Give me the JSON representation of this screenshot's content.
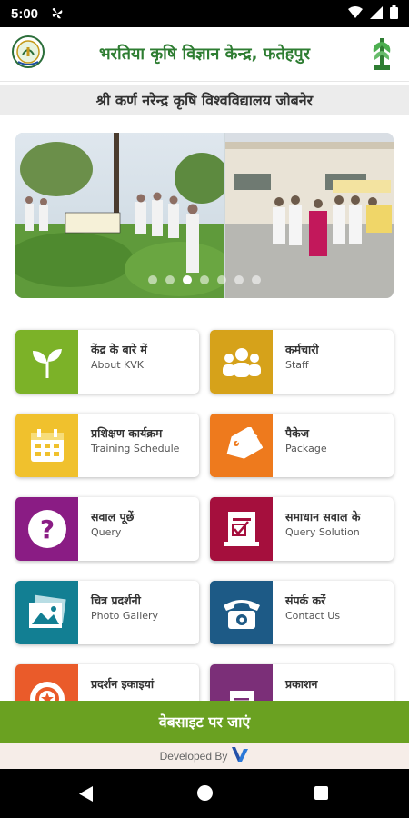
{
  "status_bar": {
    "time": "5:00",
    "left_icon": "fan-icon",
    "right_icons": [
      "wifi-icon",
      "signal-icon",
      "battery-icon"
    ]
  },
  "header": {
    "title": "भरतिया कृषि विज्ञान केन्द्र, फतेहपुर",
    "left_logo": "university-emblem-logo",
    "right_logo": "icar-logo"
  },
  "university": {
    "name": "श्री कर्ण नरेन्द्र कृषि विश्वविद्यालय जोबनेर"
  },
  "carousel": {
    "slide_count": 7,
    "active_index": 2
  },
  "menu": [
    {
      "hi": "केंद्र के बारे में",
      "en": "About KVK",
      "color": "#7cb228",
      "icon": "plant-sprout-icon"
    },
    {
      "hi": "कर्मचारी",
      "en": "Staff",
      "color": "#d6a21a",
      "icon": "people-group-icon"
    },
    {
      "hi": "प्रशिक्षण कार्यक्रम",
      "en": "Training Schedule",
      "color": "#f0c12d",
      "icon": "calendar-icon"
    },
    {
      "hi": "पैकेज",
      "en": "Package",
      "color": "#ee7a1d",
      "icon": "tag-icon"
    },
    {
      "hi": "सवाल पूछें",
      "en": "Query",
      "color": "#8a1c84",
      "icon": "question-icon"
    },
    {
      "hi": "समाधान सवाल के",
      "en": "Query Solution",
      "color": "#a50f3d",
      "icon": "document-check-icon"
    },
    {
      "hi": "चित्र प्रदर्शनी",
      "en": "Photo Gallery",
      "color": "#127f93",
      "icon": "photo-gallery-icon"
    },
    {
      "hi": "संपर्क करें",
      "en": "Contact Us",
      "color": "#1d5a86",
      "icon": "telephone-icon"
    },
    {
      "hi": "प्रदर्शन इकाइयां",
      "en": "",
      "color": "#ea5b2a",
      "icon": "badge-icon"
    },
    {
      "hi": "प्रकाशन",
      "en": "",
      "color": "#7b2f78",
      "icon": "publication-icon"
    }
  ],
  "website_button": {
    "label": "वेबसाइट पर जाएं"
  },
  "footer": {
    "developed_by": "Developed By",
    "brand_color": "#2450a8"
  },
  "colors": {
    "title_green": "#2e7d32",
    "website_green": "#6aa121"
  }
}
